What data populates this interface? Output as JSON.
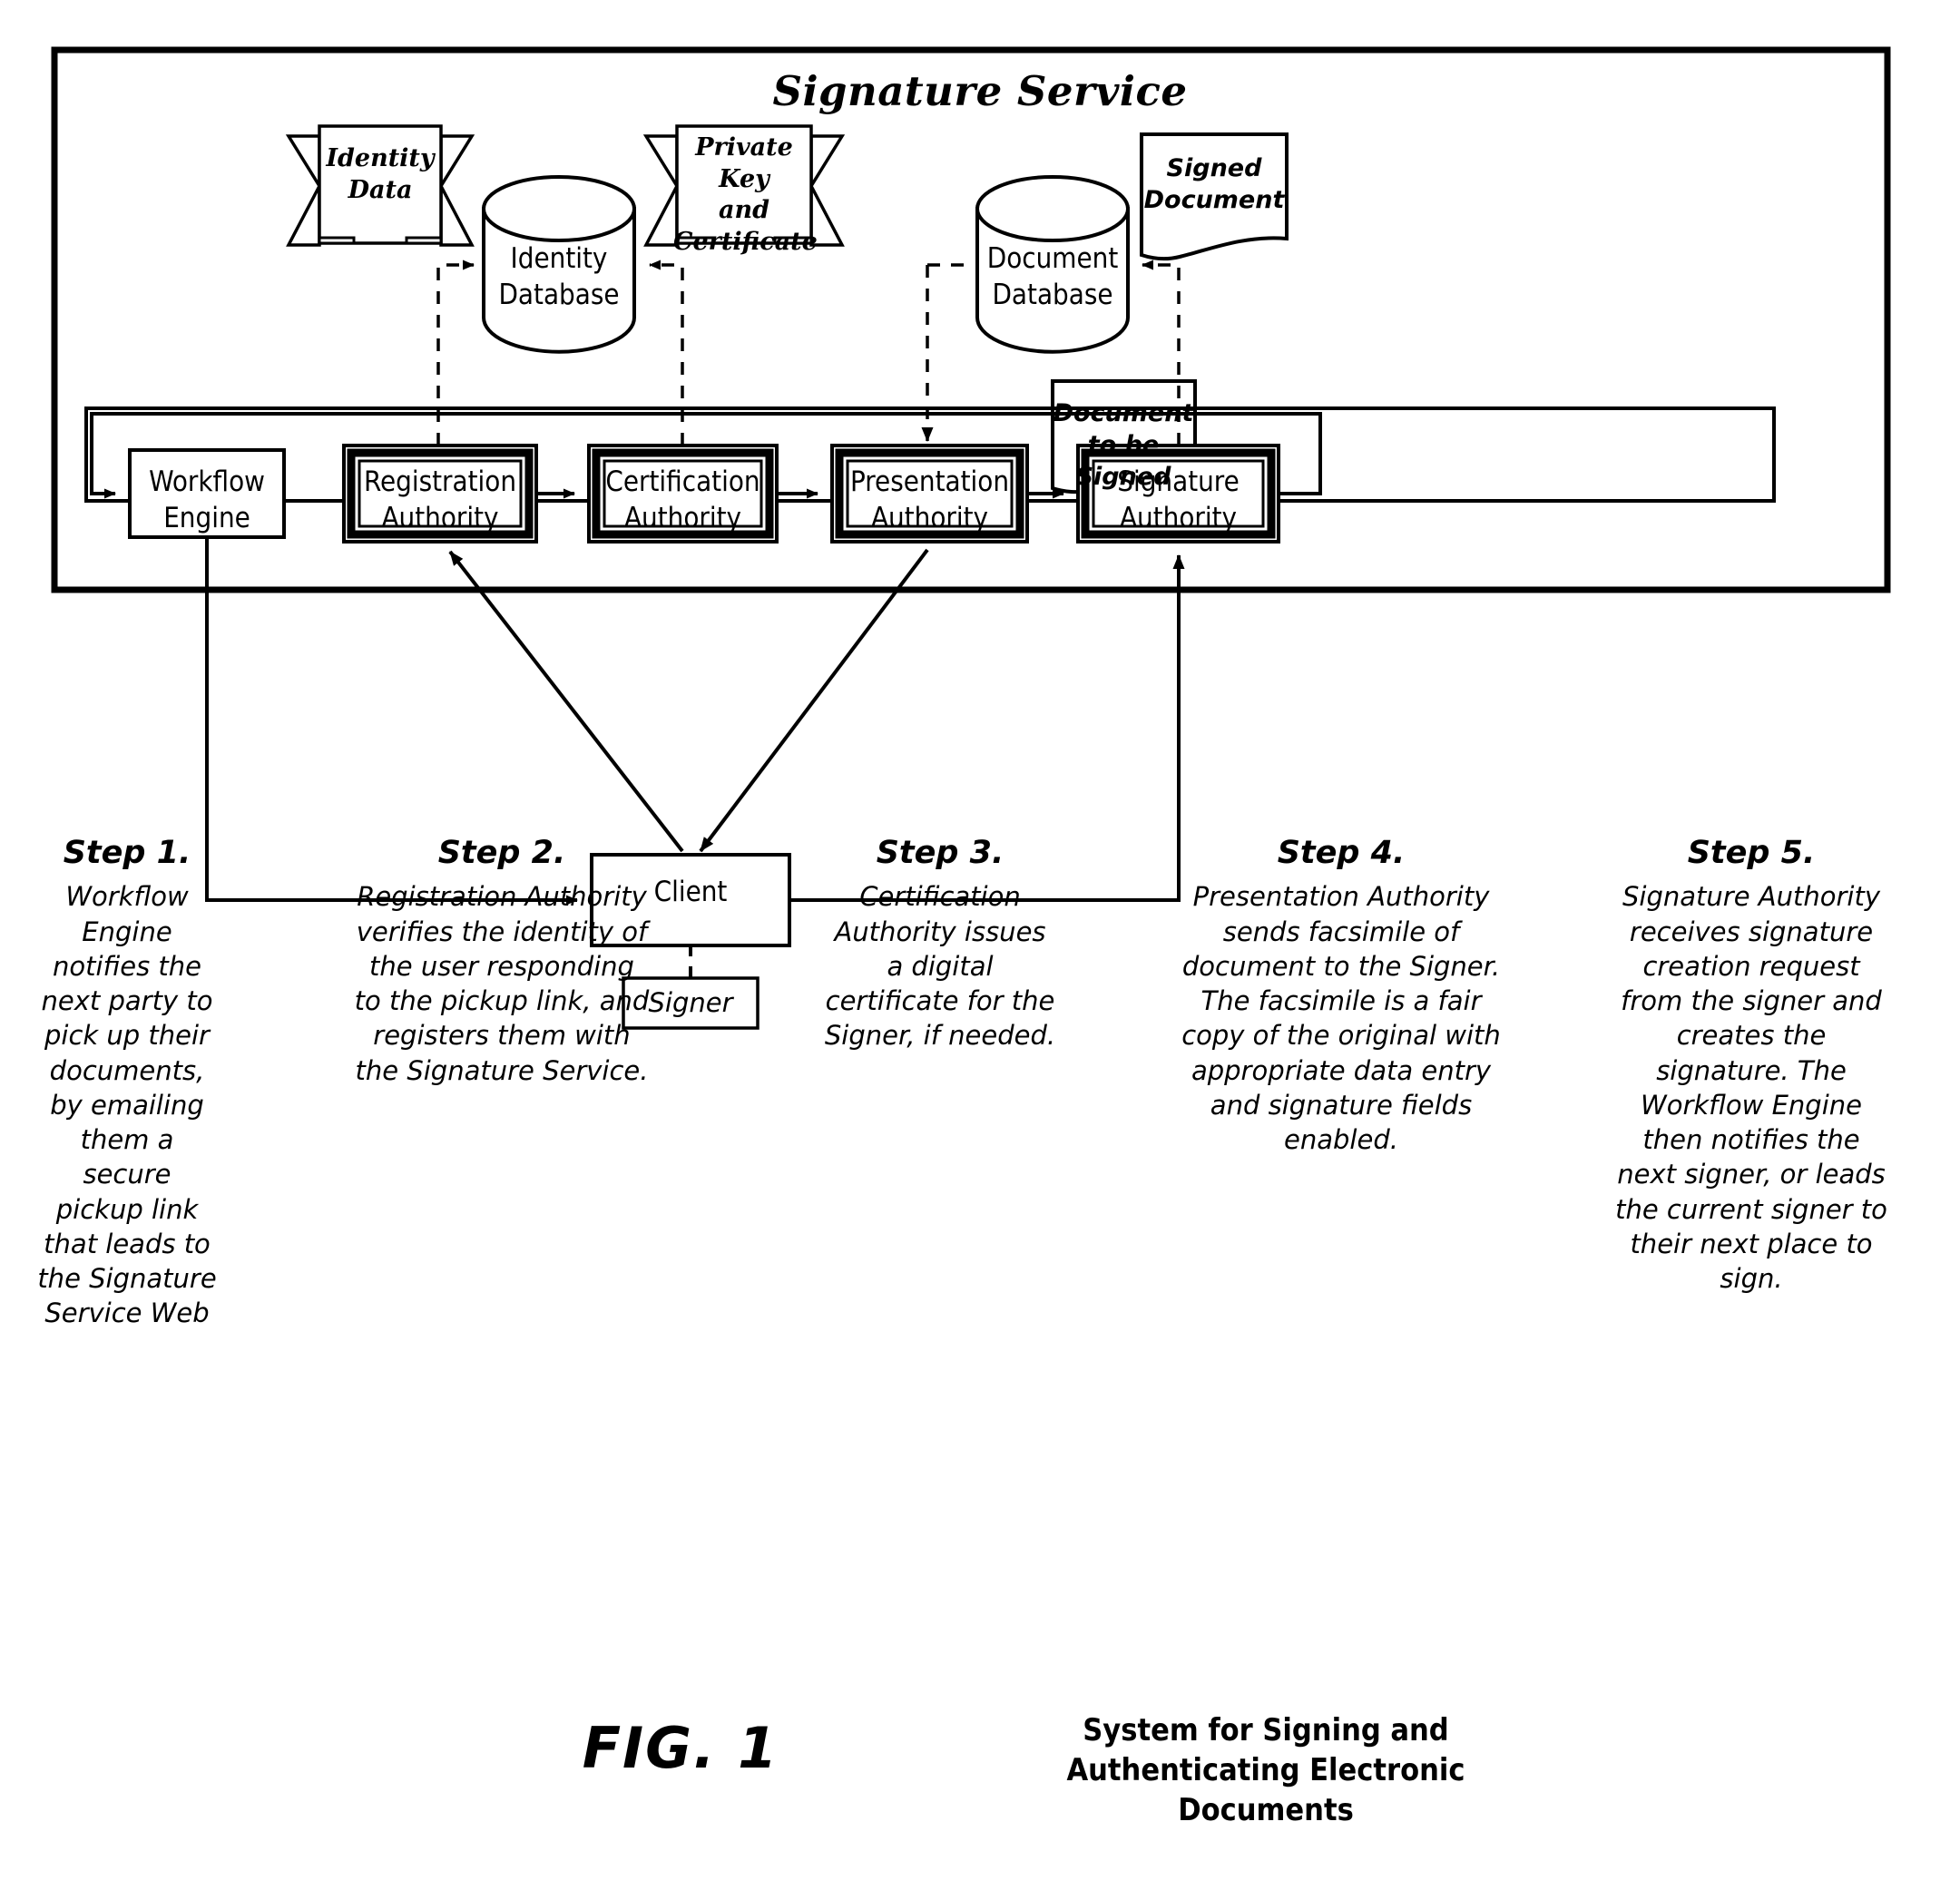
{
  "figure": {
    "number": "FIG. 1",
    "caption_lines": [
      "System for Signing and",
      "Authenticating Electronic",
      "Documents"
    ]
  },
  "system": {
    "title": "Signature Service"
  },
  "inputs": [
    {
      "name": "identity-data",
      "shape": "banner",
      "lines": [
        "Identity",
        "Data"
      ]
    },
    {
      "name": "private-key-and-certificate",
      "shape": "banner",
      "lines": [
        "Private Key",
        "and",
        "Certificate"
      ]
    },
    {
      "name": "signed-document",
      "shape": "document",
      "lines": [
        "Signed",
        "Document"
      ]
    },
    {
      "name": "document-to-be-signed",
      "shape": "document",
      "lines": [
        "Document",
        "to be Signed"
      ]
    }
  ],
  "databases": [
    {
      "name": "identity-database",
      "lines": [
        "Identity",
        "Database"
      ]
    },
    {
      "name": "document-database",
      "lines": [
        "Document",
        "Database"
      ]
    }
  ],
  "authorities": [
    {
      "name": "workflow-engine",
      "lines": [
        "Workflow",
        "Engine"
      ],
      "emphasis": "single"
    },
    {
      "name": "registration-authority",
      "lines": [
        "Registration",
        "Authority"
      ],
      "emphasis": "double"
    },
    {
      "name": "certification-authority",
      "lines": [
        "Certification",
        "Authority"
      ],
      "emphasis": "double"
    },
    {
      "name": "presentation-authority",
      "lines": [
        "Presentation",
        "Authority"
      ],
      "emphasis": "double"
    },
    {
      "name": "signature-authority",
      "lines": [
        "Signature",
        "Authority"
      ],
      "emphasis": "double"
    }
  ],
  "client": {
    "label": "Client"
  },
  "signer": {
    "label": "Signer"
  },
  "steps": [
    {
      "name": "step-1",
      "heading": "Step 1.",
      "body": "Workflow Engine notifies the next party to pick up their documents, by emailing them a secure pickup link that leads to the Signature Service Web"
    },
    {
      "name": "step-2",
      "heading": "Step 2.",
      "body": "Registration Authority verifies the identity of the user responding to the pickup link, and registers them with the Signature Service."
    },
    {
      "name": "step-3",
      "heading": "Step 3.",
      "body": "Certification Authority issues a digital certificate for the Signer, if needed."
    },
    {
      "name": "step-4",
      "heading": "Step 4.",
      "body": "Presentation Authority sends facsimile of document to the Signer. The facsimile is a fair copy of the original with appropriate data entry and signature fields enabled."
    },
    {
      "name": "step-5",
      "heading": "Step 5.",
      "body": "Signature Authority receives signature creation request from the signer and creates the signature. The Workflow Engine then notifies the next signer, or leads the current signer to their next place to sign."
    }
  ],
  "colors": {
    "ink": "#000000",
    "paper": "#ffffff"
  }
}
